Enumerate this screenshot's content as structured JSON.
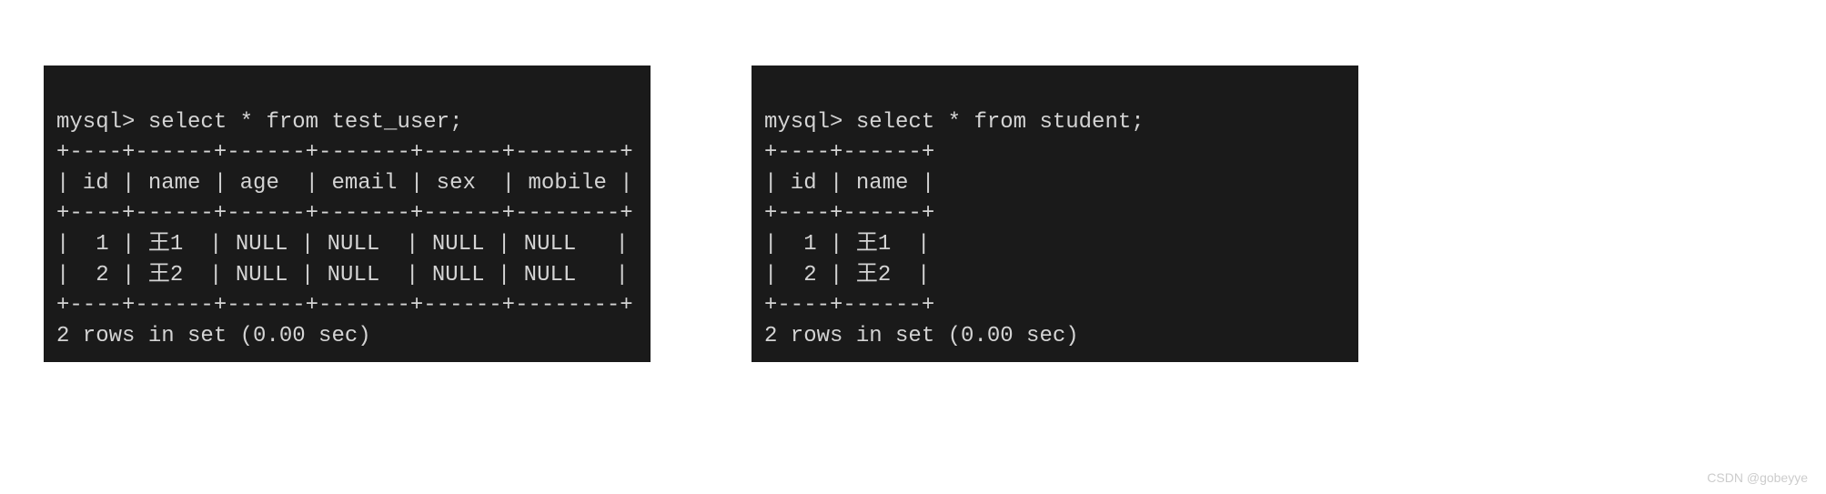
{
  "terminals": {
    "left": {
      "command": "mysql> select * from test_user;",
      "border_top": "+----+------+------+-------+------+--------+",
      "header": "| id | name | age  | email | sex  | mobile |",
      "border_mid": "+----+------+------+-------+------+--------+",
      "rows": [
        "|  1 | 王1  | NULL | NULL  | NULL | NULL   |",
        "|  2 | 王2  | NULL | NULL  | NULL | NULL   |"
      ],
      "border_bot": "+----+------+------+-------+------+--------+",
      "status": "2 rows in set (0.00 sec)"
    },
    "right": {
      "command": "mysql> select * from student;",
      "border_top": "+----+------+",
      "header": "| id | name |",
      "border_mid": "+----+------+",
      "rows": [
        "|  1 | 王1  |",
        "|  2 | 王2  |"
      ],
      "border_bot": "+----+------+",
      "status": "2 rows in set (0.00 sec)"
    }
  },
  "watermark": "CSDN @gobeyye",
  "chart_data": [
    {
      "type": "table",
      "title": "test_user",
      "columns": [
        "id",
        "name",
        "age",
        "email",
        "sex",
        "mobile"
      ],
      "rows": [
        {
          "id": 1,
          "name": "王1",
          "age": null,
          "email": null,
          "sex": null,
          "mobile": null
        },
        {
          "id": 2,
          "name": "王2",
          "age": null,
          "email": null,
          "sex": null,
          "mobile": null
        }
      ],
      "row_count": 2,
      "elapsed_sec": 0.0
    },
    {
      "type": "table",
      "title": "student",
      "columns": [
        "id",
        "name"
      ],
      "rows": [
        {
          "id": 1,
          "name": "王1"
        },
        {
          "id": 2,
          "name": "王2"
        }
      ],
      "row_count": 2,
      "elapsed_sec": 0.0
    }
  ]
}
